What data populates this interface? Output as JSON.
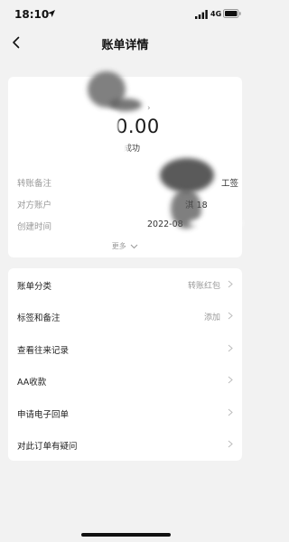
{
  "status_bar": {
    "time": "18:10",
    "network": "4G"
  },
  "nav": {
    "title": "账单详情"
  },
  "summary": {
    "amount": "000.00",
    "status": "成功"
  },
  "details": [
    {
      "label": "转账备注",
      "value": "工签"
    },
    {
      "label": "对方账户",
      "value": "淇 18"
    },
    {
      "label": "创建时间",
      "value": "2022-08"
    }
  ],
  "more_label": "更多",
  "list": [
    {
      "label": "账单分类",
      "value": "转账红包"
    },
    {
      "label": "标签和备注",
      "value": "添加"
    },
    {
      "label": "查看往来记录",
      "value": ""
    },
    {
      "label": "AA收款",
      "value": ""
    },
    {
      "label": "申请电子回单",
      "value": ""
    },
    {
      "label": "对此订单有疑问",
      "value": ""
    }
  ],
  "colors": {
    "background": "#f2f2f2",
    "card": "#ffffff",
    "muted": "#999999"
  }
}
